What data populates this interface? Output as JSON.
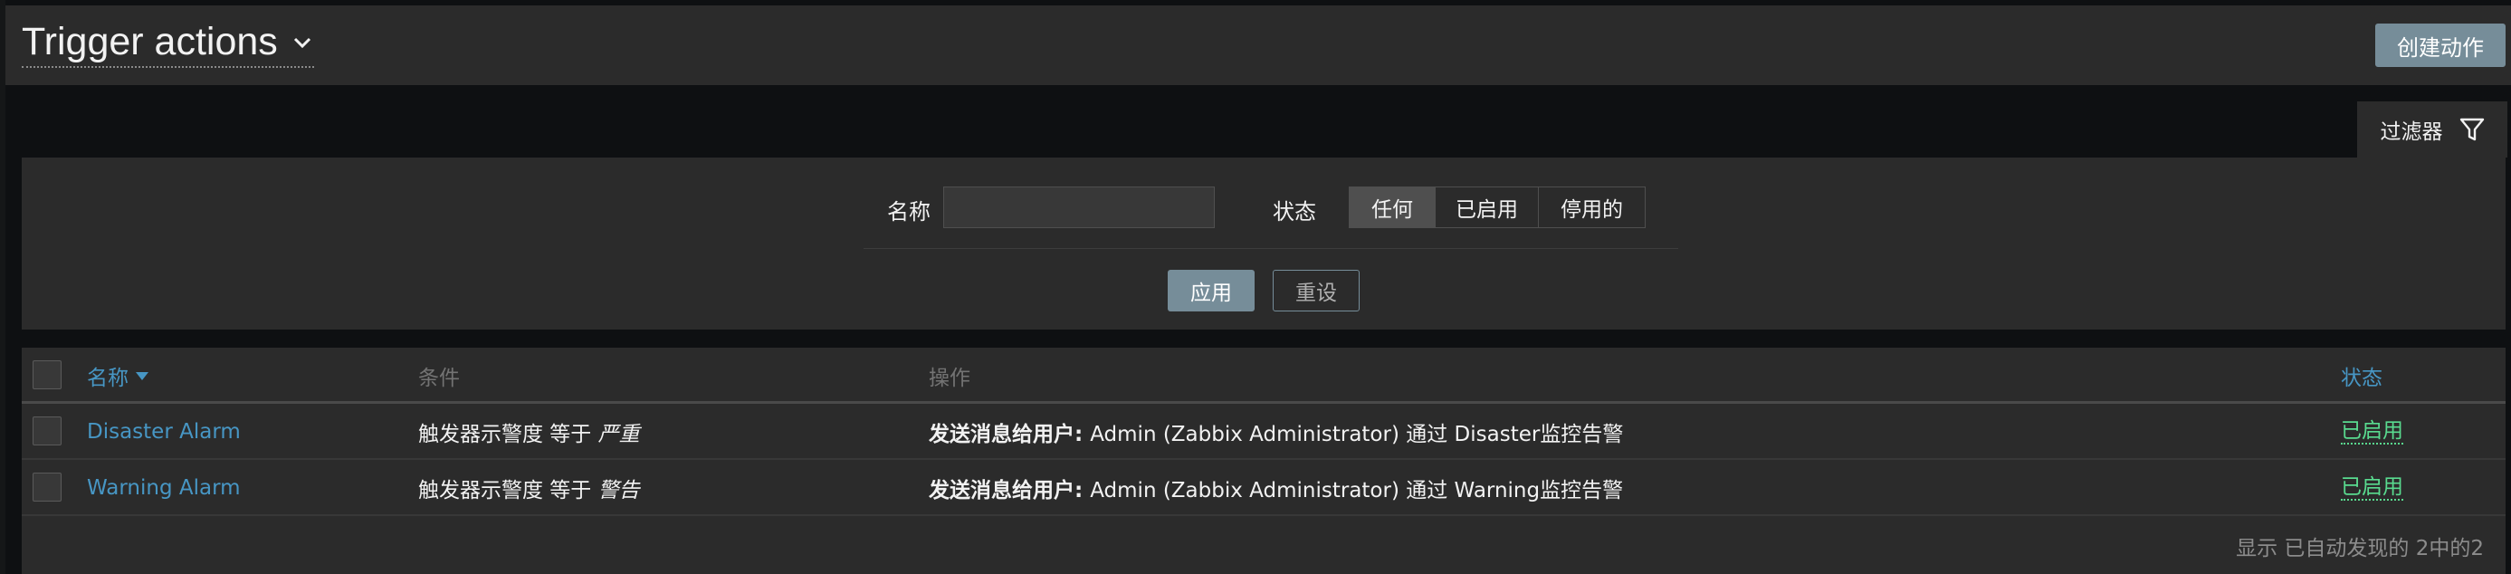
{
  "header": {
    "title": "Trigger actions",
    "create_button": "创建动作"
  },
  "filter": {
    "tab_label": "过滤器",
    "name_label": "名称",
    "name_value": "",
    "status_label": "状态",
    "status_options": [
      "任何",
      "已启用",
      "停用的"
    ],
    "status_selected": "任何",
    "apply_label": "应用",
    "reset_label": "重设"
  },
  "table": {
    "columns": {
      "name": "名称",
      "conditions": "条件",
      "operations": "操作",
      "status": "状态"
    },
    "rows": [
      {
        "name": "Disaster Alarm",
        "condition_prefix": "触发器示警度 等于 ",
        "condition_value": "严重",
        "operation_prefix": "发送消息给用户: ",
        "operation_text": "Admin (Zabbix Administrator) 通过 Disaster监控告警",
        "status": "已启用"
      },
      {
        "name": "Warning Alarm",
        "condition_prefix": "触发器示警度 等于 ",
        "condition_value": "警告",
        "operation_prefix": "发送消息给用户: ",
        "operation_text": "Admin (Zabbix Administrator) 通过 Warning监控告警",
        "status": "已启用"
      }
    ],
    "footer": "显示 已自动发现的 2中的2"
  },
  "colors": {
    "accent": "#4796c4",
    "enabled": "#59db8f",
    "button": "#768d99",
    "panel": "#2b2b2b"
  }
}
